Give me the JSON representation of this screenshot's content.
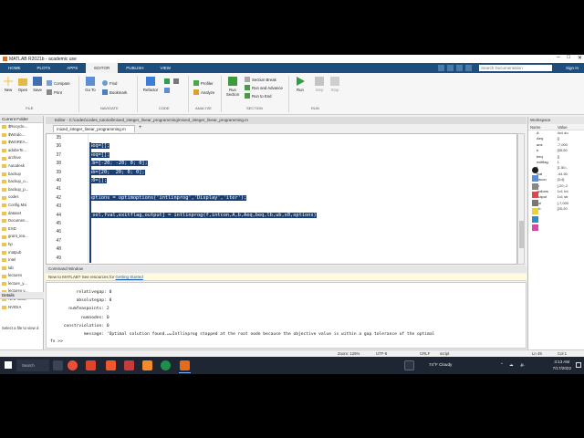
{
  "window": {
    "title": "MATLAB R2021b - academic use"
  },
  "tabs": [
    "HOME",
    "PLOTS",
    "APPS",
    "EDITOR",
    "PUBLISH",
    "VIEW"
  ],
  "active_tab": "EDITOR",
  "search": {
    "placeholder": "Search Documentation"
  },
  "signin_label": "Sign In",
  "ribbon": {
    "file": {
      "new": "New",
      "open": "Open",
      "save": "Save",
      "compare": "Compare",
      "print": "Print",
      "group": "FILE"
    },
    "navigate": {
      "goto": "Go To",
      "find": "Find",
      "bookmark": "Bookmark",
      "group": "NAVIGATE"
    },
    "code": {
      "refactor": "Refactor",
      "group": "CODE"
    },
    "analyze": {
      "profiler": "Profiler",
      "analyze": "Analyze",
      "group": "ANALYZE"
    },
    "section": {
      "run_section": "Run Section",
      "section_break": "Section Break",
      "run_and_advance": "Run and Advance",
      "run_to_end": "Run to End",
      "group": "SECTION"
    },
    "run": {
      "run": "Run",
      "step": "Step",
      "stop": "Stop",
      "group": "RUN"
    }
  },
  "current_folder": {
    "title": "Current Folder",
    "items": [
      "$Recycle...",
      "$Windo...",
      "$WinREA...",
      "adobeTe...",
      "archive",
      "Autodesk",
      "backup",
      "backup_o...",
      "backup_p...",
      "codes",
      "Config.Msi",
      "dataset",
      "Documen...",
      "ESD",
      "grant_tea...",
      "hp",
      "matpub",
      "Intel",
      "lab",
      "lectures",
      "lecture_y...",
      "lectures y...",
      "New folder",
      "NVIDIA"
    ]
  },
  "details": {
    "title": "Details",
    "hint": "Select a file to view d"
  },
  "editor": {
    "header": "Editor - C:\\codes\\codes_tutorial\\mixed_integer_linear_programming\\mixed_integer_linear_programming.m",
    "tab_name": "mixed_integer_linear_programming.m",
    "lines": [
      {
        "num": "35",
        "code": ""
      },
      {
        "num": "36",
        "code": "Aeq=[];"
      },
      {
        "num": "37",
        "code": "beq=[];"
      },
      {
        "num": "38",
        "code": "lb=[-20; -20; 0; 0];"
      },
      {
        "num": "39",
        "code": "ub=[20;  20; 0; 0];"
      },
      {
        "num": "40",
        "code": "x0=[];"
      },
      {
        "num": "41",
        "code": ""
      },
      {
        "num": "42",
        "code": "options = optimoptions('intlinprog','Display','iter');"
      },
      {
        "num": "43",
        "code": ""
      },
      {
        "num": "44",
        "code": "[sol,fval,exitflag,output] = intlinprog(f,intcon,A,b,Aeq,beq,lb,ub,x0,options)"
      },
      {
        "num": "45",
        "code": ""
      },
      {
        "num": "46",
        "code": ""
      },
      {
        "num": "47",
        "code": ""
      },
      {
        "num": "48",
        "code": ""
      },
      {
        "num": "49",
        "code": ""
      }
    ]
  },
  "command_window": {
    "title": "Command Window",
    "notice_text": "New to MATLAB? See resources for ",
    "notice_link": "Getting Started",
    "lines": [
      {
        "label": "      relativegap:",
        "value": "0"
      },
      {
        "label": "      absolutegap:",
        "value": "0"
      },
      {
        "label": "   numfeaspoints:",
        "value": "2"
      },
      {
        "label": "        numnodes:",
        "value": "0"
      },
      {
        "label": " constrviolation:",
        "value": "0"
      },
      {
        "label": "         message:",
        "value": "'Optimal solution found.↵↵Intlinprog stopped at the root node because the objective value is within a gap tolerance of the optimal"
      }
    ],
    "prompt": "fx >>"
  },
  "workspace": {
    "title": "Workspace",
    "col_name": "Name",
    "col_value": "Value",
    "rows": [
      {
        "name": "A",
        "value": "4x4 do"
      },
      {
        "name": "Aeq",
        "value": "[]"
      },
      {
        "name": "ans",
        "value": "-7,000"
      },
      {
        "name": "b",
        "value": "[55;50"
      },
      {
        "name": "beq",
        "value": "[]"
      },
      {
        "name": "exitflag",
        "value": "1"
      },
      {
        "name": "f",
        "value": "[1.50;-"
      },
      {
        "name": "fval",
        "value": "-44.50"
      },
      {
        "name": "intcon",
        "value": "[3;4]"
      },
      {
        "name": "lb",
        "value": "[-20;-2"
      },
      {
        "name": "options",
        "value": "1x1 Int"
      },
      {
        "name": "output",
        "value": "1x1 str"
      },
      {
        "name": "sol",
        "value": "[-7,000"
      },
      {
        "name": "ub",
        "value": "[20;20"
      }
    ]
  },
  "statusbar": {
    "zoom": "Zoom: 125%",
    "encoding": "UTF-8",
    "eol": "CRLF",
    "type": "script",
    "ln": "Ln  49",
    "col": "Col  1"
  },
  "taskbar": {
    "search": "Search",
    "weather": "74°F  Cloudy",
    "time": "3:13 AM",
    "date": "7/17/2022"
  },
  "colors": {
    "tabstrip": "#1e4e7e",
    "selection": "#1c3f73",
    "taskbar": "#1f2633"
  }
}
